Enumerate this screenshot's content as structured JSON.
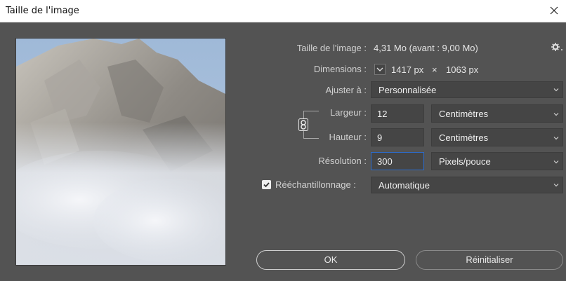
{
  "window": {
    "title": "Taille de l'image"
  },
  "info": {
    "size_label": "Taille de l'image :",
    "size_value": "4,31 Mo (avant : 9,00 Mo)",
    "dimensions_label": "Dimensions :",
    "dim_width": "1417 px",
    "dim_times": "×",
    "dim_height": "1063 px"
  },
  "fit": {
    "label": "Ajuster à :",
    "value": "Personnalisée"
  },
  "width": {
    "label": "Largeur :",
    "value": "12",
    "unit": "Centimètres"
  },
  "height": {
    "label": "Hauteur :",
    "value": "9",
    "unit": "Centimètres"
  },
  "resolution": {
    "label": "Résolution :",
    "value": "300",
    "unit": "Pixels/pouce"
  },
  "resample": {
    "label": "Rééchantillonnage :",
    "value": "Automatique",
    "checked": true
  },
  "buttons": {
    "ok": "OK",
    "reset": "Réinitialiser"
  },
  "colors": {
    "background": "#535353",
    "field": "#454545",
    "focus": "#2d6bc9"
  }
}
